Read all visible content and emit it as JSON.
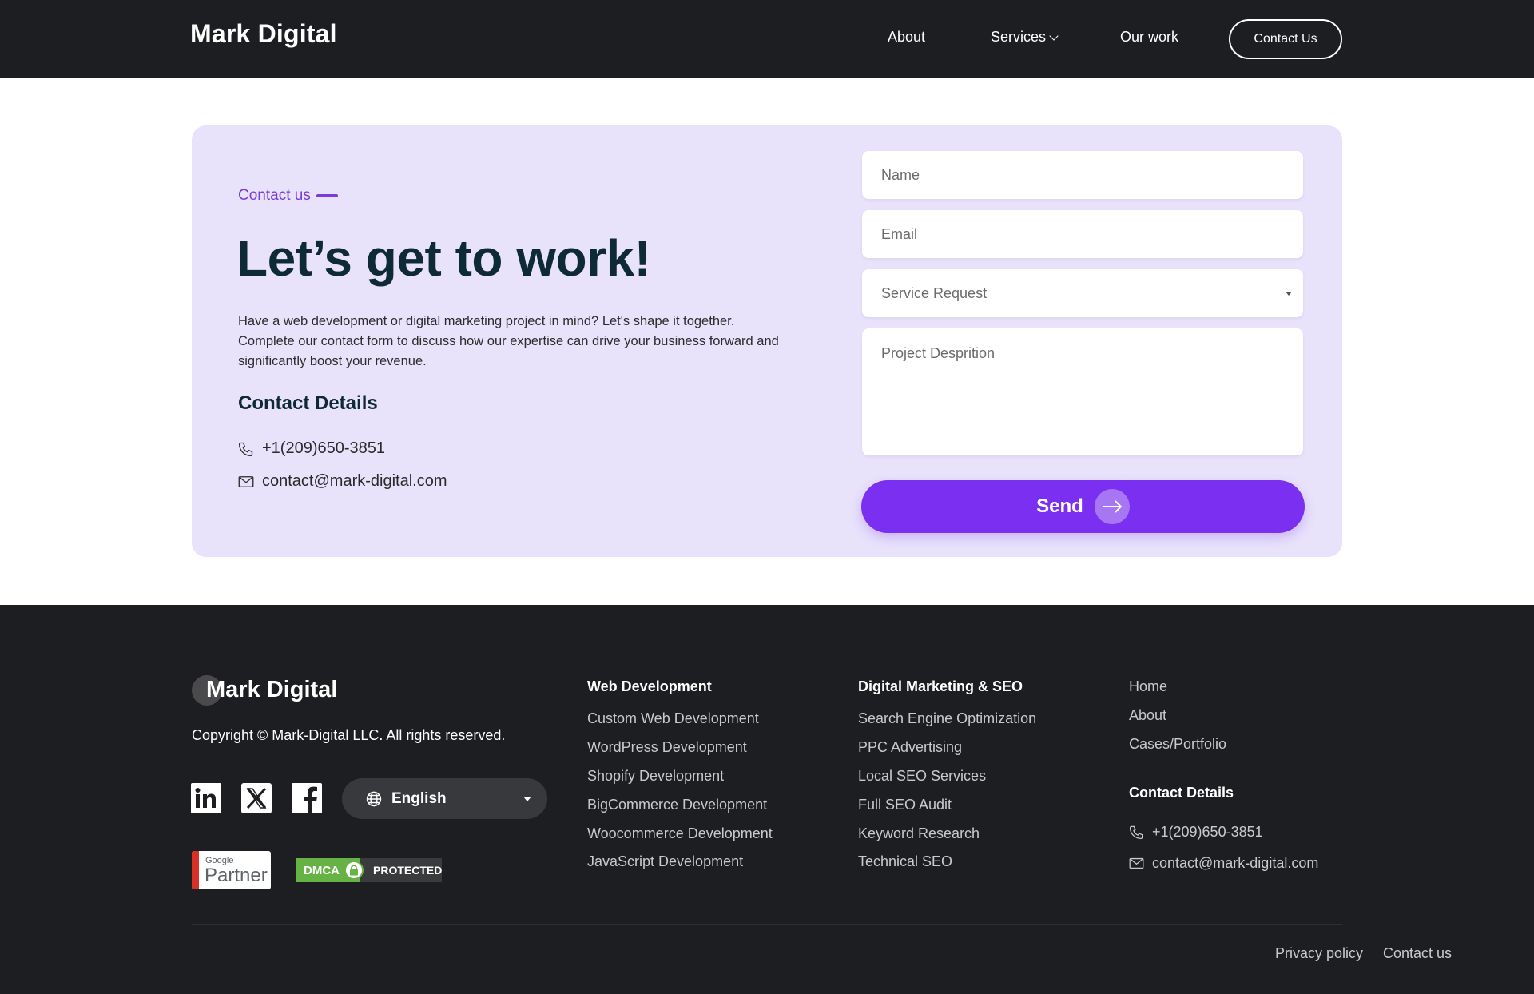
{
  "header": {
    "logo": "Mark Digital",
    "nav": {
      "about": "About",
      "services": "Services",
      "our_work": "Our work"
    },
    "contact_button": "Contact Us"
  },
  "contact": {
    "eyebrow": "Contact us",
    "headline": "Let’s get to work!",
    "description": "Have a web development or digital marketing project in mind? Let's shape it together. Complete our contact form to discuss how our expertise can drive your business forward and significantly boost your revenue.",
    "details_title": "Contact Details",
    "phone": "+1(209)650-3851",
    "email": "contact@mark-digital.com"
  },
  "form": {
    "name_placeholder": "Name",
    "email_placeholder": "Email",
    "service_placeholder": "Service Request",
    "project_placeholder": "Project Desprition",
    "send_label": "Send"
  },
  "footer": {
    "logo": "Mark Digital",
    "copyright": "Copyright © Mark-Digital LLC. All rights reserved.",
    "language": "English",
    "badges": {
      "google_small": "Google",
      "google_big": "Partner",
      "dmca_left": "DMCA",
      "dmca_right": "PROTECTED"
    },
    "web_dev": {
      "title": "Web Development",
      "links": [
        "Custom Web Development",
        "WordPress Development",
        "Shopify Development",
        "BigCommerce Development",
        "Woocommerce Development",
        "JavaScript Development"
      ]
    },
    "marketing": {
      "title": "Digital Marketing & SEO",
      "links": [
        "Search Engine Optimization",
        "PPC Advertising",
        "Local SEO Services",
        "Full SEO Audit",
        "Keyword Research",
        "Technical SEO"
      ]
    },
    "site_links": [
      "Home",
      "About",
      "Cases/Portfolio"
    ],
    "contact_title": "Contact Details",
    "phone": "+1(209)650-3851",
    "email": "contact@mark-digital.com",
    "privacy": "Privacy policy",
    "contact_us": "Contact us"
  },
  "colors": {
    "dark_bg": "#1d1e21",
    "card_bg": "#e8e2fb",
    "accent": "#7b2ff0",
    "heading": "#0e2a35"
  }
}
